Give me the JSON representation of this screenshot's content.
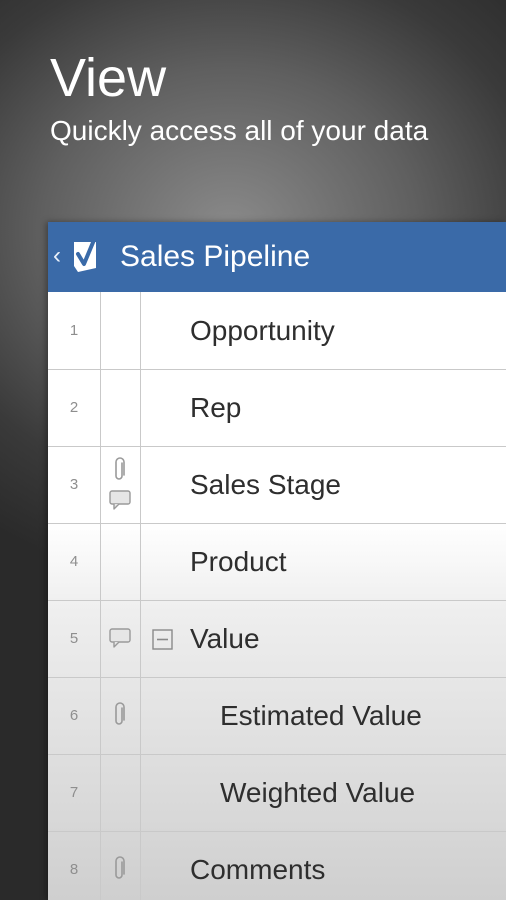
{
  "hero": {
    "title": "View",
    "subtitle": "Quickly access all of your data"
  },
  "appbar": {
    "title": "Sales Pipeline",
    "back_icon": "chevron-left-icon",
    "logo_icon": "smartsheet-check-logo",
    "color": "#3a6aa8"
  },
  "rows": [
    {
      "num": "1",
      "label": "Opportunity"
    },
    {
      "num": "2",
      "label": "Rep"
    },
    {
      "num": "3",
      "label": "Sales Stage"
    },
    {
      "num": "4",
      "label": "Product"
    },
    {
      "num": "5",
      "label": "Value"
    },
    {
      "num": "6",
      "label": "Estimated Value"
    },
    {
      "num": "7",
      "label": "Weighted Value"
    },
    {
      "num": "8",
      "label": "Comments"
    }
  ],
  "icons": {
    "attachment": "paperclip-icon",
    "comment": "comment-bubble-icon",
    "collapse": "collapse-minus-icon"
  }
}
